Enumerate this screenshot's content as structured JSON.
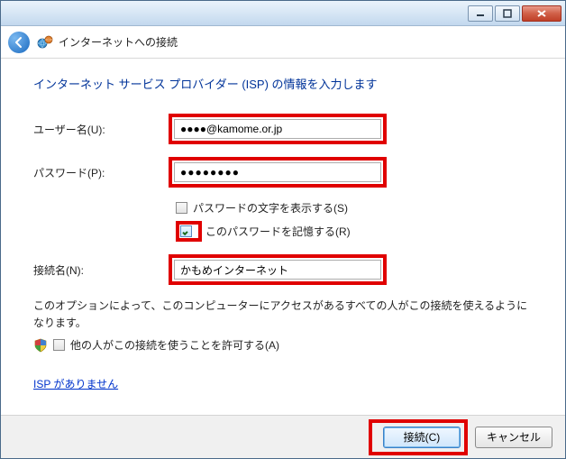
{
  "window": {
    "title": "インターネットへの接続"
  },
  "page": {
    "instruction": "インターネット サービス プロバイダー (ISP) の情報を入力します"
  },
  "form": {
    "username_label": "ユーザー名(U):",
    "username_value": "●●●●@kamome.or.jp",
    "password_label": "パスワード(P):",
    "password_value": "●●●●●●●●",
    "show_password_label": "パスワードの文字を表示する(S)",
    "show_password_checked": false,
    "remember_password_label": "このパスワードを記憶する(R)",
    "remember_password_checked": true,
    "connection_name_label": "接続名(N):",
    "connection_name_value": "かもめインターネット"
  },
  "share": {
    "description": "このオプションによって、このコンピューターにアクセスがあるすべての人がこの接続を使えるようになります。",
    "allow_others_label": "他の人がこの接続を使うことを許可する(A)",
    "allow_others_checked": false
  },
  "link": {
    "no_isp": "ISP がありません"
  },
  "buttons": {
    "connect": "接続(C)",
    "cancel": "キャンセル"
  }
}
